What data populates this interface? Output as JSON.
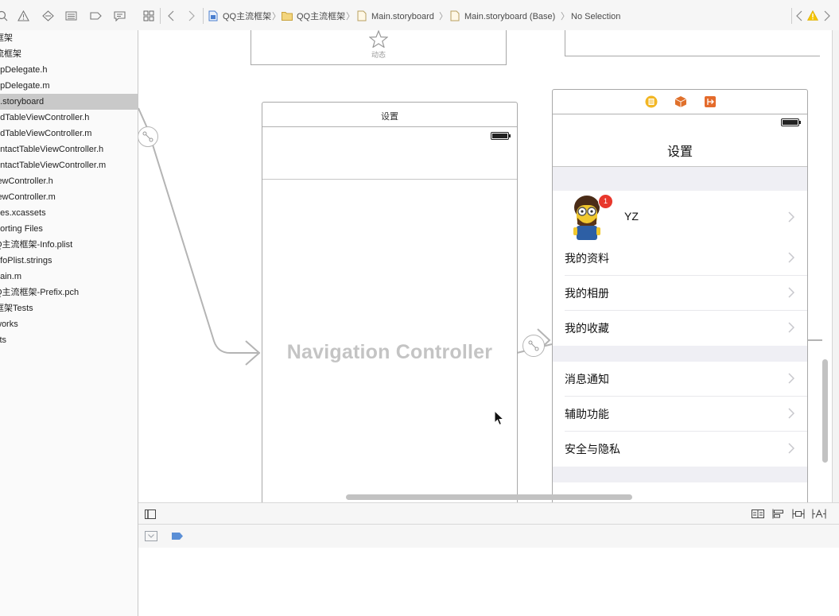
{
  "navigator": {
    "files": [
      {
        "label": "框架",
        "selected": false
      },
      {
        "label": "流框架",
        "selected": false
      },
      {
        "label": "ppDelegate.h",
        "selected": false
      },
      {
        "label": "ppDelegate.m",
        "selected": false
      },
      {
        "label": "n.storyboard",
        "selected": true
      },
      {
        "label": "ddTableViewController.h",
        "selected": false
      },
      {
        "label": "ddTableViewController.m",
        "selected": false
      },
      {
        "label": "ontactTableViewController.h",
        "selected": false
      },
      {
        "label": "ontactTableViewController.m",
        "selected": false
      },
      {
        "label": "iewController.h",
        "selected": false
      },
      {
        "label": "iewController.m",
        "selected": false
      },
      {
        "label": "ges.xcassets",
        "selected": false
      },
      {
        "label": "porting Files",
        "selected": false
      },
      {
        "label": "Q主流框架-Info.plist",
        "selected": false
      },
      {
        "label": "nfoPlist.strings",
        "selected": false
      },
      {
        "label": "nain.m",
        "selected": false
      },
      {
        "label": "Q主流框架-Prefix.pch",
        "selected": false
      },
      {
        "label": "框架Tests",
        "selected": false
      },
      {
        "label": "works",
        "selected": false
      },
      {
        "label": "cts",
        "selected": false
      }
    ]
  },
  "jumpbar": {
    "crumb1": "QQ主流框架",
    "crumb2": "QQ主流框架",
    "crumb3": "Main.storyboard",
    "crumb4": "Main.storyboard (Base)",
    "crumb5": "No Selection"
  },
  "canvas": {
    "top_scene_label": "动态",
    "nav_scene": {
      "title": "设置",
      "watermark": "Navigation Controller"
    },
    "settings_scene": {
      "nav_title": "设置",
      "profile": {
        "name": "YZ",
        "badge": "1"
      },
      "group1": [
        "我的资料",
        "我的相册",
        "我的收藏"
      ],
      "group2": [
        "消息通知",
        "辅助功能",
        "安全与隐私"
      ]
    }
  },
  "colors": {
    "warning": "#f5c400",
    "badge": "#e8372c",
    "folder": "#e9c25a",
    "debug_tag": "#5b8fd6"
  }
}
